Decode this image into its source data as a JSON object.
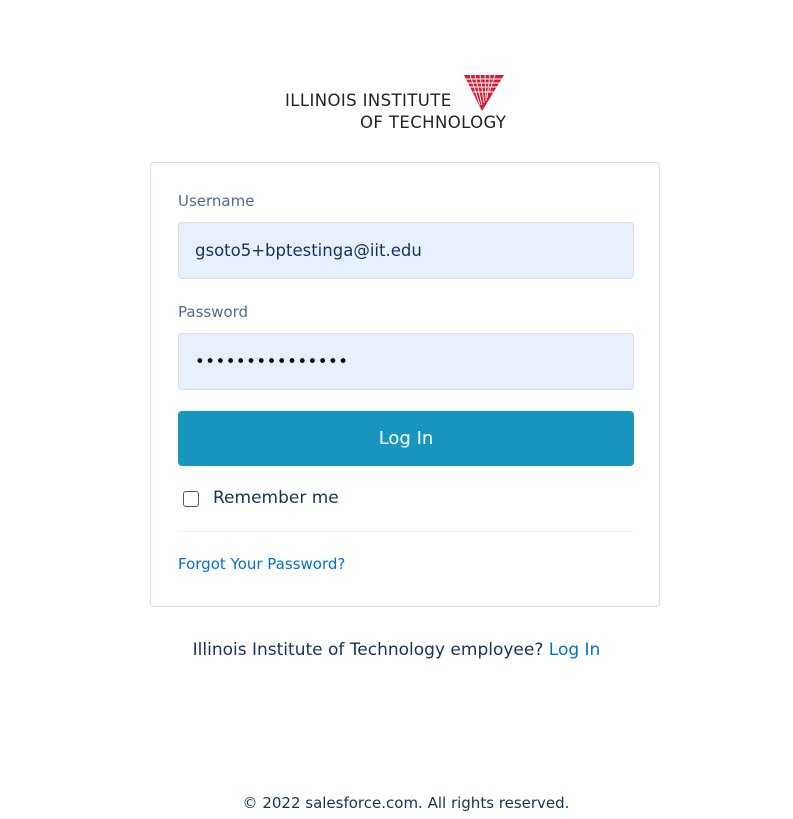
{
  "logo": {
    "line1": "ILLINOIS INSTITUTE",
    "line2": "OF TECHNOLOGY",
    "mark_color": "#d41c36"
  },
  "login_form": {
    "username_label": "Username",
    "username_value": "gsoto5+bptestinga@iit.edu",
    "password_label": "Password",
    "password_value": "•••••••••••••••",
    "login_button": "Log In",
    "remember_label": "Remember me",
    "remember_checked": false,
    "forgot_link": "Forgot Your Password?"
  },
  "employee_prompt": {
    "text": "Illinois Institute of Technology employee?",
    "link": "Log In"
  },
  "footer": {
    "copyright": "© 2022 salesforce.com. All rights reserved."
  },
  "colors": {
    "button": "#1797c0",
    "field_bg": "#e8f0fe",
    "link": "#0070d2",
    "text": "#16325c"
  }
}
